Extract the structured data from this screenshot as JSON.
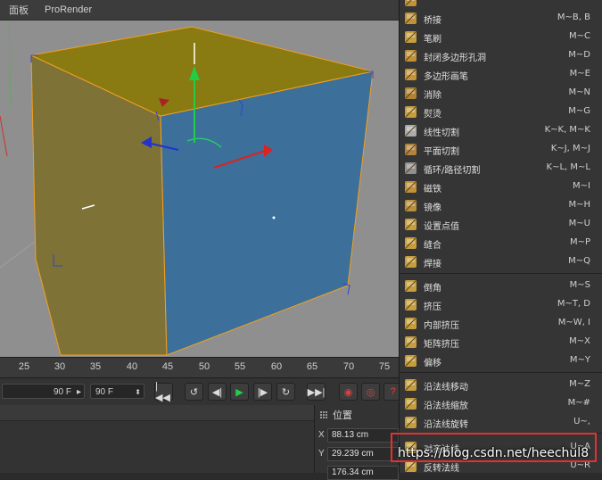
{
  "viewport": {
    "menu": [
      "面板",
      "ProRender"
    ]
  },
  "timeline": {
    "ticks": [
      "25",
      "30",
      "35",
      "40",
      "45",
      "50",
      "55",
      "60",
      "65",
      "70",
      "75"
    ],
    "start_frame": "90 F",
    "end_frame": "90 F"
  },
  "playback": {
    "buttons": [
      {
        "name": "go-to-start-button",
        "glyph": "⏮"
      },
      {
        "name": "loop-back-button",
        "glyph": "↺"
      },
      {
        "name": "prev-frame-button",
        "glyph": "◀|"
      },
      {
        "name": "play-button",
        "glyph": "▶"
      },
      {
        "name": "next-frame-button",
        "glyph": "|▶"
      },
      {
        "name": "loop-forward-button",
        "glyph": "↻"
      },
      {
        "name": "go-to-end-button",
        "glyph": "⏭"
      },
      {
        "name": "record-button",
        "glyph": "●"
      },
      {
        "name": "auto-key-button",
        "glyph": "●"
      },
      {
        "name": "key-options-button",
        "glyph": "?"
      }
    ]
  },
  "coordinates": {
    "title": "位置",
    "x_label": "X",
    "x_value": "88.13 cm",
    "y_label": "Y",
    "y_value": "29.239 cm",
    "z_value": "176.34 cm"
  },
  "menu": {
    "items": [
      {
        "label": "",
        "shortcut": "",
        "icon": "top-partial-icon"
      },
      {
        "label": "桥接",
        "shortcut": "M~B, B",
        "icon": "bridge-icon"
      },
      {
        "label": "笔刷",
        "shortcut": "M~C",
        "icon": "brush-icon"
      },
      {
        "label": "封闭多边形孔洞",
        "shortcut": "M~D",
        "icon": "close-hole-icon"
      },
      {
        "label": "多边形画笔",
        "shortcut": "M~E",
        "icon": "polygon-pen-icon"
      },
      {
        "label": "消除",
        "shortcut": "M~N",
        "icon": "dissolve-icon"
      },
      {
        "label": "熨烫",
        "shortcut": "M~G",
        "icon": "iron-icon"
      },
      {
        "label": "线性切割",
        "shortcut": "K~K, M~K",
        "icon": "line-cut-icon"
      },
      {
        "label": "平面切割",
        "shortcut": "K~J, M~J",
        "icon": "plane-cut-icon"
      },
      {
        "label": "循环/路径切割",
        "shortcut": "K~L, M~L",
        "icon": "loop-cut-icon"
      },
      {
        "label": "磁铁",
        "shortcut": "M~I",
        "icon": "magnet-icon"
      },
      {
        "label": "镜像",
        "shortcut": "M~H",
        "icon": "mirror-icon"
      },
      {
        "label": "设置点值",
        "shortcut": "M~U",
        "icon": "set-point-value-icon"
      },
      {
        "label": "缝合",
        "shortcut": "M~P",
        "icon": "stitch-icon"
      },
      {
        "label": "焊接",
        "shortcut": "M~Q",
        "icon": "weld-icon"
      },
      {
        "label": "倒角",
        "shortcut": "M~S",
        "icon": "bevel-icon"
      },
      {
        "label": "挤压",
        "shortcut": "M~T, D",
        "icon": "extrude-icon"
      },
      {
        "label": "内部挤压",
        "shortcut": "M~W, I",
        "icon": "extrude-inner-icon"
      },
      {
        "label": "矩阵挤压",
        "shortcut": "M~X",
        "icon": "matrix-extrude-icon"
      },
      {
        "label": "偏移",
        "shortcut": "M~Y",
        "icon": "offset-icon"
      },
      {
        "label": "沿法线移动",
        "shortcut": "M~Z",
        "icon": "normal-move-icon"
      },
      {
        "label": "沿法线缩放",
        "shortcut": "M~#",
        "icon": "normal-scale-icon"
      },
      {
        "label": "沿法线旋转",
        "shortcut": "U~,",
        "icon": "normal-rotate-icon"
      },
      {
        "label": "对齐法线",
        "shortcut": "U~A",
        "icon": "align-normals-icon"
      },
      {
        "label": "反转法线",
        "shortcut": "U~R",
        "icon": "reverse-normals-icon"
      }
    ]
  },
  "watermark": "https://blog.csdn.net/heechul8",
  "colors": {
    "cube_top": "#8a7a12",
    "cube_left": "#7e7237",
    "cube_right": "#3c6f9a",
    "edge": "#f0a020",
    "highlight": "#e53030",
    "menu_bg": "#353535"
  }
}
